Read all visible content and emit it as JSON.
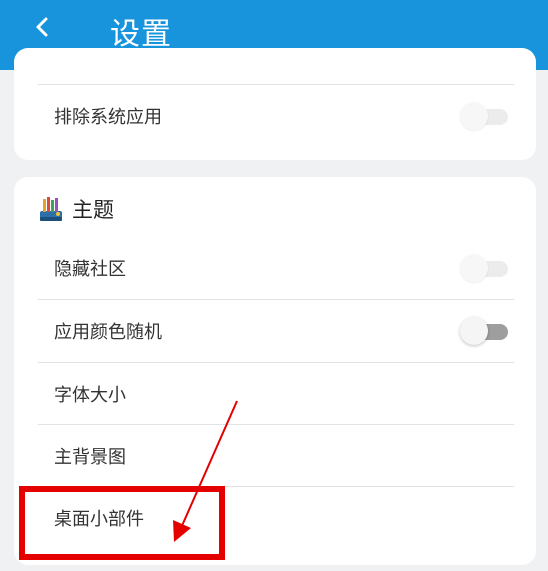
{
  "header": {
    "title": "设置",
    "back_icon": "chevron-left-icon"
  },
  "card_system": {
    "items": [
      {
        "label": "排除系统应用",
        "toggle": "faded-off"
      }
    ]
  },
  "section_theme": {
    "icon": "theme-palette-icon",
    "title": "主题",
    "items": [
      {
        "label": "隐藏社区",
        "toggle": "faded-off"
      },
      {
        "label": "应用颜色随机",
        "toggle": "off"
      },
      {
        "label": "字体大小"
      },
      {
        "label": "主背景图"
      },
      {
        "label": "桌面小部件"
      }
    ]
  },
  "colors": {
    "appbar": "#1894dc",
    "highlight": "#e50000",
    "background": "#f0f1f3"
  }
}
